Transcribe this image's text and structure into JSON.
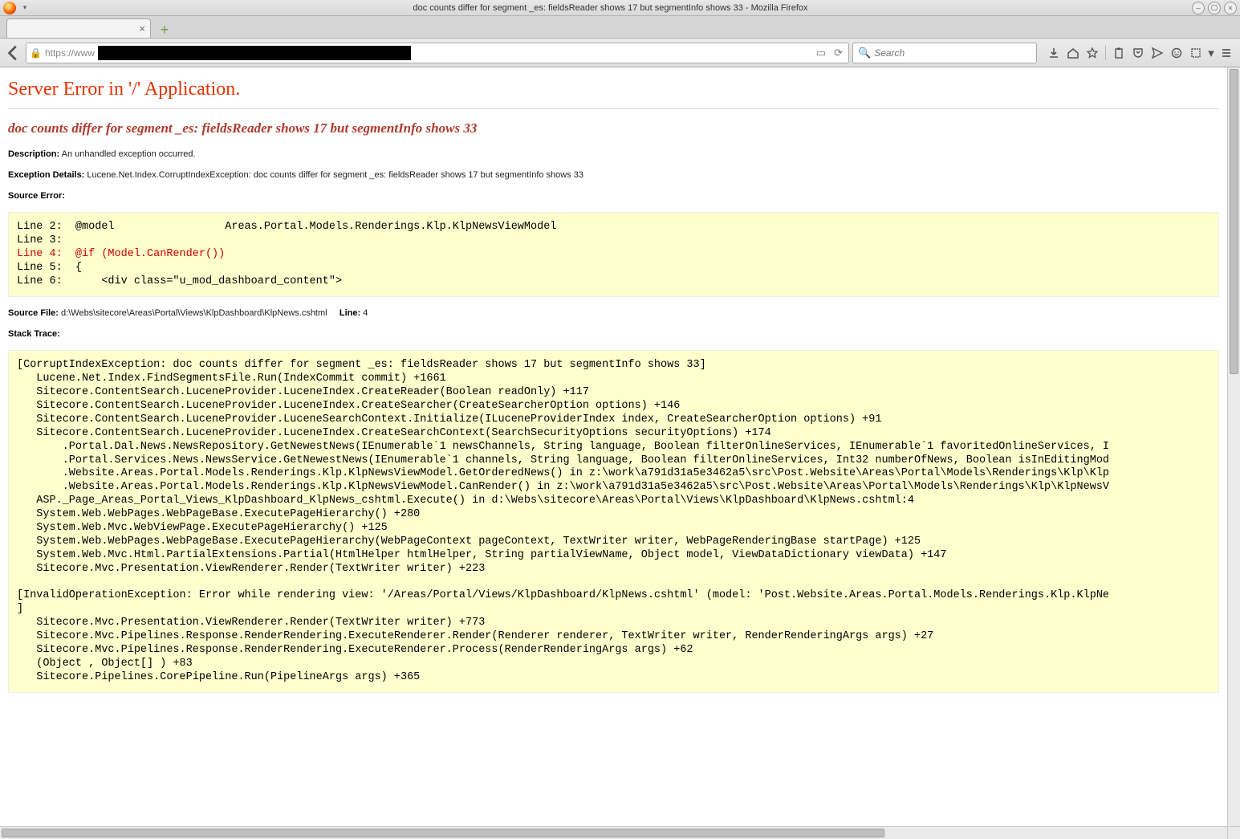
{
  "window": {
    "title": "doc counts differ for segment _es: fieldsReader shows 17 but segmentInfo shows 33 - Mozilla Firefox"
  },
  "tab": {
    "title": ""
  },
  "urlbar": {
    "prefix": "https://www"
  },
  "searchbar": {
    "placeholder": "Search"
  },
  "error": {
    "header": "Server Error in '/' Application.",
    "title": "doc counts differ for segment _es: fieldsReader shows 17 but segmentInfo shows 33",
    "description_label": "Description:",
    "description_text": "An unhandled exception occurred.",
    "exception_label": "Exception Details:",
    "exception_text": "Lucene.Net.Index.CorruptIndexException: doc counts differ for segment _es: fieldsReader shows 17 but segmentInfo shows 33",
    "source_error_label": "Source Error:",
    "source_code": "Line 2:  @model                 Areas.Portal.Models.Renderings.Klp.KlpNewsViewModel\nLine 3:  \n",
    "source_code_hl": "Line 4:  @if (Model.CanRender())\n",
    "source_code_after": "Line 5:  {\nLine 6:      <div class=\"u_mod_dashboard_content\">",
    "source_file_label": "Source File:",
    "source_file": "d:\\Webs\\sitecore\\Areas\\Portal\\Views\\KlpDashboard\\KlpNews.cshtml",
    "line_label": "Line:",
    "line": "4",
    "stack_label": "Stack Trace:",
    "stack": "[CorruptIndexException: doc counts differ for segment _es: fieldsReader shows 17 but segmentInfo shows 33]\n   Lucene.Net.Index.FindSegmentsFile.Run(IndexCommit commit) +1661\n   Sitecore.ContentSearch.LuceneProvider.LuceneIndex.CreateReader(Boolean readOnly) +117\n   Sitecore.ContentSearch.LuceneProvider.LuceneIndex.CreateSearcher(CreateSearcherOption options) +146\n   Sitecore.ContentSearch.LuceneProvider.LuceneSearchContext.Initialize(ILuceneProviderIndex index, CreateSearcherOption options) +91\n   Sitecore.ContentSearch.LuceneProvider.LuceneIndex.CreateSearchContext(SearchSecurityOptions securityOptions) +174\n       .Portal.Dal.News.NewsRepository.GetNewestNews(IEnumerable`1 newsChannels, String language, Boolean filterOnlineServices, IEnumerable`1 favoritedOnlineServices, I\n       .Portal.Services.News.NewsService.GetNewestNews(IEnumerable`1 channels, String language, Boolean filterOnlineServices, Int32 numberOfNews, Boolean isInEditingMod\n       .Website.Areas.Portal.Models.Renderings.Klp.KlpNewsViewModel.GetOrderedNews() in z:\\work\\a791d31a5e3462a5\\src\\Post.Website\\Areas\\Portal\\Models\\Renderings\\Klp\\Klp\n       .Website.Areas.Portal.Models.Renderings.Klp.KlpNewsViewModel.CanRender() in z:\\work\\a791d31a5e3462a5\\src\\Post.Website\\Areas\\Portal\\Models\\Renderings\\Klp\\KlpNewsV\n   ASP._Page_Areas_Portal_Views_KlpDashboard_KlpNews_cshtml.Execute() in d:\\Webs\\sitecore\\Areas\\Portal\\Views\\KlpDashboard\\KlpNews.cshtml:4\n   System.Web.WebPages.WebPageBase.ExecutePageHierarchy() +280\n   System.Web.Mvc.WebViewPage.ExecutePageHierarchy() +125\n   System.Web.WebPages.WebPageBase.ExecutePageHierarchy(WebPageContext pageContext, TextWriter writer, WebPageRenderingBase startPage) +125\n   System.Web.Mvc.Html.PartialExtensions.Partial(HtmlHelper htmlHelper, String partialViewName, Object model, ViewDataDictionary viewData) +147\n   Sitecore.Mvc.Presentation.ViewRenderer.Render(TextWriter writer) +223\n\n[InvalidOperationException: Error while rendering view: '/Areas/Portal/Views/KlpDashboard/KlpNews.cshtml' (model: 'Post.Website.Areas.Portal.Models.Renderings.Klp.KlpNe\n]\n   Sitecore.Mvc.Presentation.ViewRenderer.Render(TextWriter writer) +773\n   Sitecore.Mvc.Pipelines.Response.RenderRendering.ExecuteRenderer.Render(Renderer renderer, TextWriter writer, RenderRenderingArgs args) +27\n   Sitecore.Mvc.Pipelines.Response.RenderRendering.ExecuteRenderer.Process(RenderRenderingArgs args) +62\n   (Object , Object[] ) +83\n   Sitecore.Pipelines.CorePipeline.Run(PipelineArgs args) +365"
  }
}
